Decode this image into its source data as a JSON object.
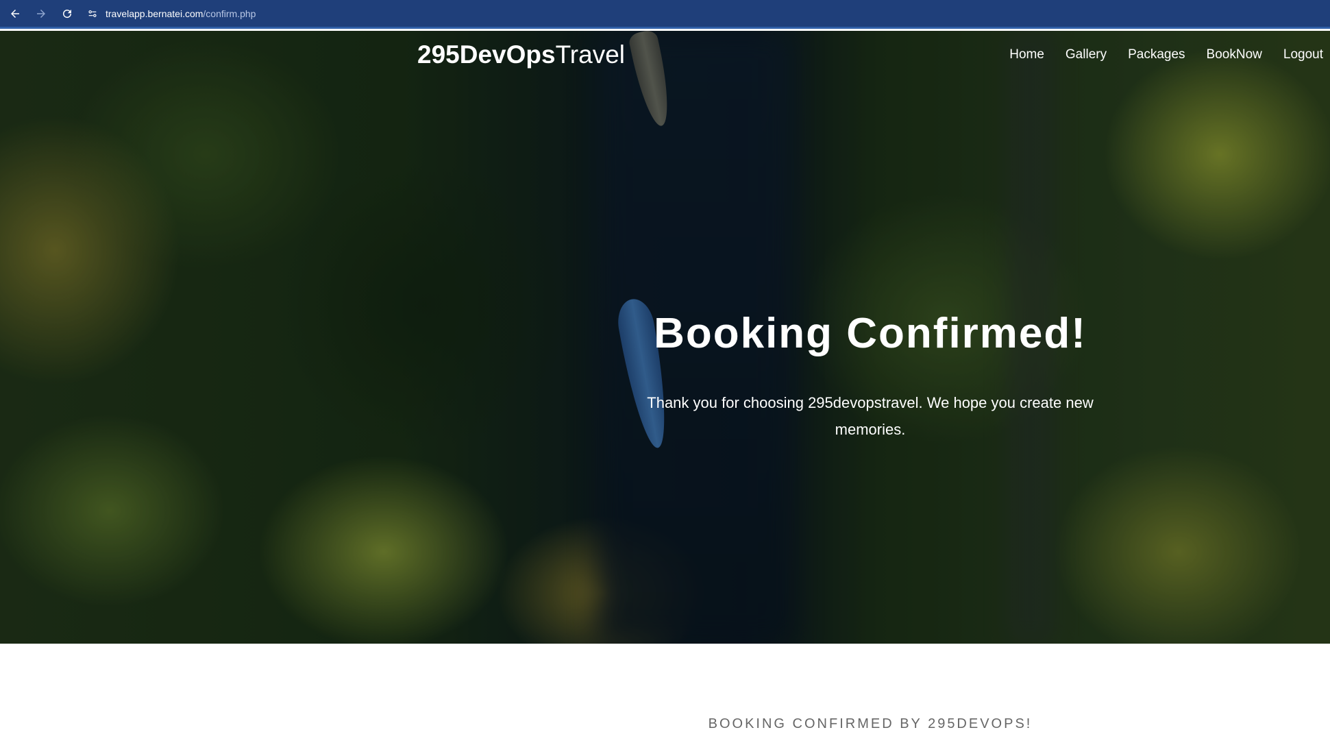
{
  "browser": {
    "url_host": "travelapp.bernatei.com",
    "url_path": "/confirm.php",
    "back_icon": "back-arrow-icon",
    "forward_icon": "forward-arrow-icon",
    "reload_icon": "reload-icon",
    "site_info_icon": "site-info-icon",
    "bar_color": "#1f3f7a"
  },
  "header": {
    "brand_bold": "295DevOps",
    "brand_light": "Travel",
    "nav": [
      {
        "label": "Home"
      },
      {
        "label": "Gallery"
      },
      {
        "label": "Packages"
      },
      {
        "label": "BookNow"
      },
      {
        "label": "Logout"
      }
    ]
  },
  "hero": {
    "title": "Booking Confirmed!",
    "subtitle": "Thank you for choosing 295devopstravel. We hope you create new memories."
  },
  "confirmation": {
    "caption": "BOOKING CONFIRMED BY 295DEVOPS!"
  }
}
